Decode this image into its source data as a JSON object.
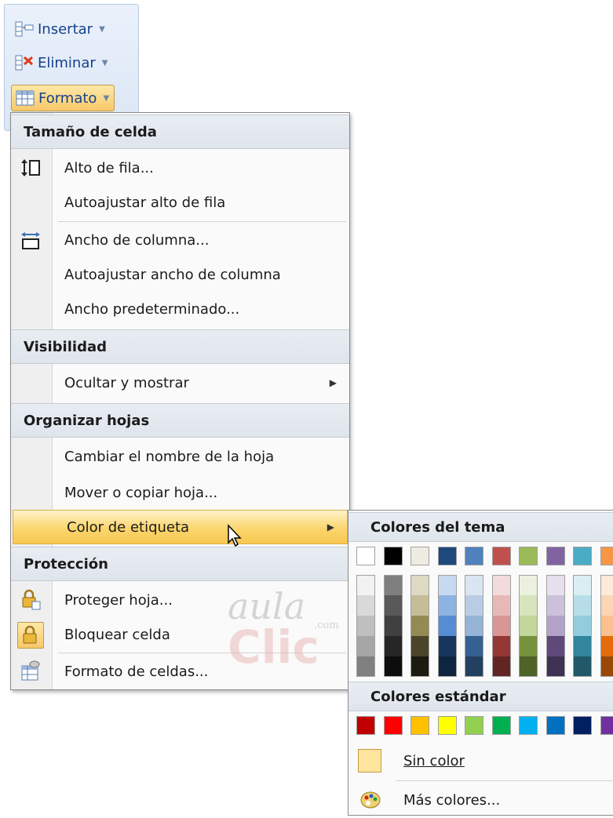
{
  "ribbon": {
    "insert_label": "Insertar",
    "delete_label": "Eliminar",
    "format_label": "Formato"
  },
  "menu": {
    "sections": {
      "cell_size": "Tamaño de celda",
      "visibility": "Visibilidad",
      "organize": "Organizar hojas",
      "protection": "Protección"
    },
    "items": {
      "row_height": "Alto de fila...",
      "autofit_row": "Autoajustar alto de fila",
      "col_width": "Ancho de columna...",
      "autofit_col": "Autoajustar ancho de columna",
      "default_width": "Ancho predeterminado...",
      "hide_show": "Ocultar y mostrar",
      "rename_sheet": "Cambiar el nombre de la hoja",
      "move_copy": "Mover o copiar hoja...",
      "tab_color": "Color de etiqueta",
      "protect_sheet": "Proteger hoja...",
      "lock_cell": "Bloquear celda",
      "format_cells": "Formato de celdas..."
    }
  },
  "submenu": {
    "theme_header": "Colores del tema",
    "standard_header": "Colores estándar",
    "no_color": "Sin color",
    "more_colors": "Más colores..."
  },
  "colors": {
    "theme": [
      [
        "#ffffff",
        "#f2f2f2",
        "#d9d9d9",
        "#bfbfbf",
        "#a6a6a6",
        "#808080"
      ],
      [
        "#000000",
        "#7f7f7f",
        "#595959",
        "#404040",
        "#262626",
        "#0d0d0d"
      ],
      [
        "#eeece1",
        "#ddd9c3",
        "#c4bd97",
        "#948a54",
        "#4a452a",
        "#1d1b10"
      ],
      [
        "#1f497d",
        "#c6d9f1",
        "#8db3e2",
        "#548dd4",
        "#17365d",
        "#0f243e"
      ],
      [
        "#4f81bd",
        "#dbe5f1",
        "#b8cce4",
        "#95b3d7",
        "#366092",
        "#244061"
      ],
      [
        "#c0504d",
        "#f2dcdb",
        "#e6b9b8",
        "#d99694",
        "#953735",
        "#632523"
      ],
      [
        "#9bbb59",
        "#ebf1de",
        "#d7e4bd",
        "#c3d69b",
        "#76923c",
        "#4f6228"
      ],
      [
        "#8064a2",
        "#e5e0ec",
        "#ccc1da",
        "#b3a2c7",
        "#5f497a",
        "#3f3151"
      ],
      [
        "#4bacc6",
        "#dbeef4",
        "#b7dee8",
        "#93cddd",
        "#31859c",
        "#215968"
      ],
      [
        "#f79646",
        "#fdeada",
        "#fbd5b5",
        "#fac08f",
        "#e46c0a",
        "#984807"
      ]
    ],
    "standard": [
      "#c00000",
      "#ff0000",
      "#ffc000",
      "#ffff00",
      "#92d050",
      "#00b050",
      "#00b0f0",
      "#0070c0",
      "#002060",
      "#7030a0"
    ],
    "highlight": "#f8c851"
  },
  "watermark": {
    "line1": "aula",
    "line2": "Clic",
    "domain": ".com"
  }
}
